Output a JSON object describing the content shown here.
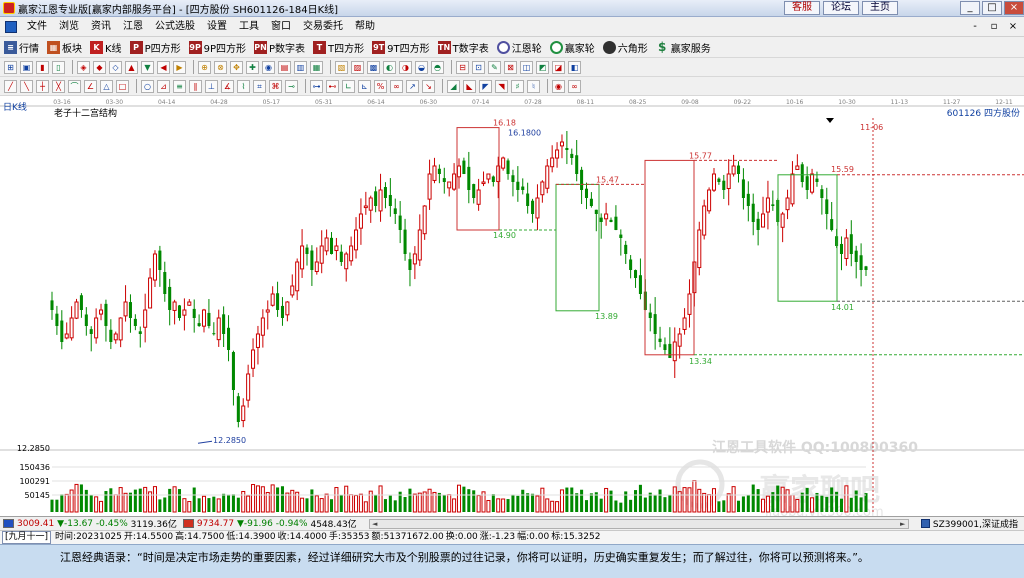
{
  "titlebar": {
    "title": "赢家江恩专业版[赢家内部服务平台] - [四方股份  SH601126-184日K线]",
    "buttons": [
      "客服",
      "论坛",
      "主页"
    ]
  },
  "menu": {
    "items": [
      "文件",
      "浏览",
      "资讯",
      "江恩",
      "公式选股",
      "设置",
      "工具",
      "窗口",
      "交易委托",
      "帮助"
    ]
  },
  "toolbar1": {
    "items": [
      {
        "label": "行情",
        "icon": "grid-icon"
      },
      {
        "label": "板块",
        "icon": "blocks-icon"
      },
      {
        "label": "K线",
        "icon": "kline-icon"
      },
      {
        "label": "P四方形",
        "icon": "p-square-icon"
      },
      {
        "label": "9P四方形",
        "icon": "9p-square-icon"
      },
      {
        "label": "P数字表",
        "icon": "p-table-icon"
      },
      {
        "label": "T四方形",
        "icon": "t-square-icon"
      },
      {
        "label": "9T四方形",
        "icon": "9t-square-icon"
      },
      {
        "label": "T数字表",
        "icon": "t-table-icon"
      },
      {
        "label": "江恩轮",
        "icon": "gann-wheel-icon"
      },
      {
        "label": "赢家轮",
        "icon": "winner-wheel-icon"
      },
      {
        "label": "六角形",
        "icon": "hexagon-icon"
      },
      {
        "label": "赢家服务",
        "icon": "dollar-icon"
      }
    ]
  },
  "chart": {
    "period_label": "日K线",
    "structure_label": "老子十二宫结构",
    "stock_label": "601126  四方股份",
    "date_axis": [
      "03-16",
      "03-30",
      "04-14",
      "04-28",
      "05-17",
      "05-31",
      "06-14",
      "06-30",
      "07-14",
      "07-28",
      "08-11",
      "08-25",
      "09-08",
      "09-22",
      "10-16",
      "10-30",
      "11-13",
      "11-27",
      "12-11"
    ],
    "forecast_date": "11-06",
    "price_labels": {
      "high_0718": "16.18",
      "high_0718_b": "16.1800",
      "low_0425": "12.2850",
      "low_0425_b": "12.2850",
      "box1_low": "14.90",
      "box2_high": "15.47",
      "box2_low": "13.89",
      "box3_high": "15.77",
      "box3_low": "13.34",
      "box4_high": "15.59",
      "box4_low": "14.01"
    },
    "volume_axis": [
      "150436",
      "100291",
      "50145"
    ],
    "price_axis_value": "12.2850",
    "watermark": "江恩工具软件   QQ:100800360",
    "watermark2": "赢家聊吧",
    "watermark3": "liaoba.vic360.com"
  },
  "chart_data": {
    "type": "candlestick",
    "title": "老子十二宫结构",
    "xlabel": "",
    "ylabel": "",
    "x_ticks": [
      "03-16",
      "03-30",
      "04-14",
      "04-28",
      "05-17",
      "05-31",
      "06-14",
      "06-30",
      "07-14",
      "07-28",
      "08-11",
      "08-25",
      "09-08",
      "09-22",
      "10-16",
      "10-30",
      "11-13",
      "11-27",
      "12-11"
    ],
    "ylim": [
      12.2,
      16.3
    ],
    "marked_levels": [
      16.18,
      12.285,
      14.9,
      15.47,
      13.89,
      15.77,
      13.34,
      15.59,
      14.01
    ],
    "last_close": 14.4,
    "series": [
      {
        "values": [
          13.9,
          13.7,
          13.5,
          13.6,
          13.8,
          14.0,
          13.9,
          13.7,
          13.6,
          13.8,
          13.9,
          13.7,
          13.5,
          13.6,
          13.8,
          14.0,
          13.8,
          13.7,
          13.6,
          13.9,
          14.3,
          14.6,
          14.4,
          14.1,
          13.9,
          14.0,
          13.8,
          13.9,
          14.0,
          13.8,
          13.7,
          13.9,
          13.7,
          13.6,
          13.8,
          13.6,
          13.4,
          12.9,
          12.5,
          12.7,
          13.1,
          13.4,
          13.6,
          13.8,
          13.9,
          14.1,
          13.9,
          13.8,
          14.0,
          14.2,
          14.5,
          14.7,
          14.6,
          14.4,
          14.5,
          14.7,
          14.8,
          14.6,
          14.7,
          14.5,
          14.6,
          14.7,
          14.9,
          15.1,
          15.2,
          15.3,
          15.2,
          15.4,
          15.3,
          15.2,
          15.1,
          14.9,
          14.6,
          14.4,
          14.6,
          14.9,
          15.2,
          15.6,
          15.7,
          15.6,
          15.5,
          15.5,
          15.6,
          15.7,
          15.6,
          15.4,
          15.3,
          15.4,
          15.5,
          15.6,
          15.5,
          15.7,
          15.8,
          15.6,
          15.5,
          15.4,
          15.4,
          15.2,
          15.1,
          15.3,
          15.5,
          15.7,
          15.8,
          15.9,
          16.0,
          15.9,
          15.8,
          15.6,
          15.4,
          15.3,
          15.2,
          15.1,
          15.0,
          15.1,
          15.0,
          14.9,
          14.8,
          14.6,
          14.4,
          14.3,
          14.1,
          13.9,
          13.8,
          13.6,
          13.5,
          13.4,
          13.3,
          13.5,
          13.6,
          13.8,
          14.1,
          14.5,
          14.9,
          15.2,
          15.4,
          15.6,
          15.5,
          15.4,
          15.6,
          15.7,
          15.6,
          15.3,
          15.2,
          15.0,
          14.9,
          15.1,
          15.3,
          15.2,
          15.0,
          15.1,
          15.3,
          15.6,
          15.7,
          15.5,
          15.4,
          15.6,
          15.5,
          15.3,
          15.1,
          14.9,
          14.7,
          14.6,
          14.8,
          14.6,
          14.5,
          14.4,
          14.4
        ]
      }
    ],
    "volume_ylim": [
      0,
      200000
    ]
  },
  "status": {
    "sh_index": "3009.41",
    "sh_change": "▼-13.67",
    "sh_pct": "-0.45%",
    "sh_amount": "3119.36亿",
    "sz_index": "9734.77",
    "sz_change": "▼-91.96",
    "sz_pct": "-0.94%",
    "sz_amount": "4548.43亿",
    "right_code": "SZ399001,深证成指"
  },
  "quote": {
    "period": "[九月十一]",
    "segments": [
      "时间:20231025",
      "开:14.5500",
      "高:14.7500",
      "低:14.3900",
      "收:14.4000",
      "手:35353",
      "额:51371672.00",
      "换:0.00",
      "涨:-1.23",
      "幅:0.00",
      "标:15.3252"
    ]
  },
  "footer": {
    "quote_text": "江恩经典语录：“时间是决定市场走势的重要因素，经过详细研究大市及个别股票的过往记录，你将可以证明，历史确实重复发生；而了解过往，你将可以预测将来。”。"
  },
  "colors": {
    "up": "#cc0000",
    "down": "#008800",
    "box_red": "#cc3333",
    "box_green": "#33aa33"
  }
}
